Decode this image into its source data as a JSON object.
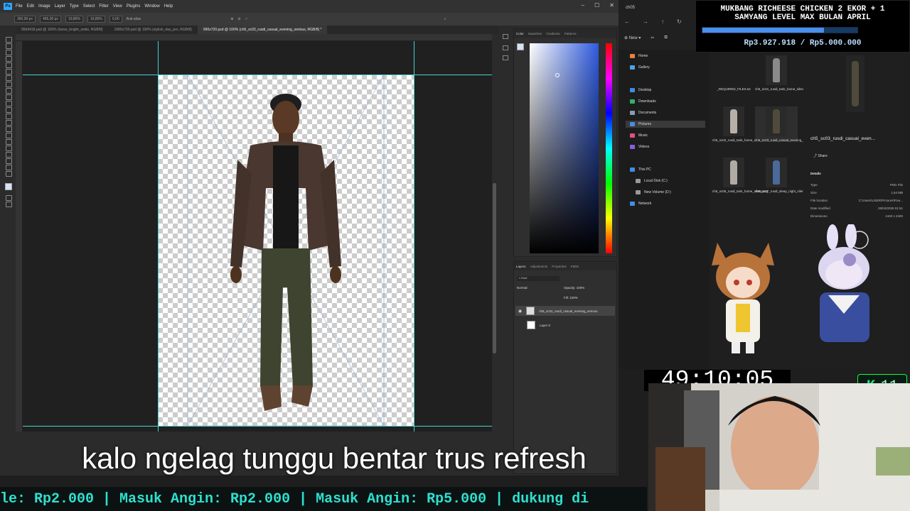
{
  "photoshop": {
    "menu": [
      "File",
      "Edit",
      "Image",
      "Layer",
      "Type",
      "Select",
      "Filter",
      "View",
      "Plugins",
      "Window",
      "Help"
    ],
    "options": {
      "x": "360,00 px",
      "y": "495,00 px",
      "w": "19,80%",
      "h": "19,80%",
      "angle": "0,00",
      "interp": "Anti-alias"
    },
    "tabs": [
      "95b9418.psd @ 100% (loose_knight_smile, RGB/8)",
      "1080x720.psd @ 100% (stylish_day_pro, RGB/8)",
      "990x720.psd @ 100% (ch5_sc03_rusdi_casual_evening_serious, RGB/8) *"
    ],
    "panel_tabs_color": [
      "Color",
      "Swatches",
      "Gradients",
      "Patterns"
    ],
    "panel_tabs_layers": [
      "Layers",
      "Adjustments",
      "Properties",
      "Paths"
    ],
    "blend_mode": "Normal",
    "opacity": "Opacity: 100%",
    "fill": "Fill: 100%",
    "layers": [
      {
        "name": "ch5_sc02_rusdi_casual_evening_serious"
      },
      {
        "name": "Layer 0"
      }
    ]
  },
  "subtitle": "kalo ngelag tunggu bentar trus refresh",
  "ticker": "le: Rp2.000 | Masuk Angin: Rp2.000 | Masuk Angin: Rp5.000 |  dukung di",
  "explorer": {
    "title": "ch05",
    "new_label": "New",
    "sidebar": [
      "Home",
      "Gallery",
      "Desktop",
      "Downloads",
      "Documents",
      "Pictures",
      "Music",
      "Videos",
      "This PC",
      "Local Disk (C:)",
      "New Volume (D:)",
      "Network"
    ],
    "files": [
      "_REQUIRED_FILES.txt",
      "ch5_sc01_rusdi_tank_home_silent.png",
      "ch5_sc02_rusdi_tank_home_serious.png",
      "ch5_sc03_rusdi_casual_evening_serious.png",
      "ch5_sc05_rusdi_tank_home_silent.png",
      "ch5_sc07_rusdi_sleep_night_silent.png"
    ],
    "detail_name": "ch5_sc03_rusdi_casual_even...",
    "share": "Share",
    "details_header": "Details",
    "details": [
      [
        "Type",
        "PNG File"
      ],
      [
        "Size",
        "1,64 MB"
      ],
      [
        "File location",
        "C:\\Users\\USER\\Pictures\\Five..."
      ],
      [
        "Date modified",
        "28/04/2026 01:51"
      ],
      [
        "Dimensions",
        "1340 x 2400"
      ]
    ]
  },
  "donation": {
    "line1": "MUKBANG RICHEESE CHICKEN 2 EKOR + 1",
    "line2": "SAMYANG LEVEL MAX BULAN APRIL",
    "amount": "Rp3.927.918 / Rp5.000.000",
    "progress": 0.7856
  },
  "timer": "49:10:05",
  "badge": {
    "letter": "K",
    "count": "11"
  },
  "colors": {
    "accent": "#31a8ff",
    "ticker": "#2de0cf",
    "guide": "#48d1cc"
  }
}
